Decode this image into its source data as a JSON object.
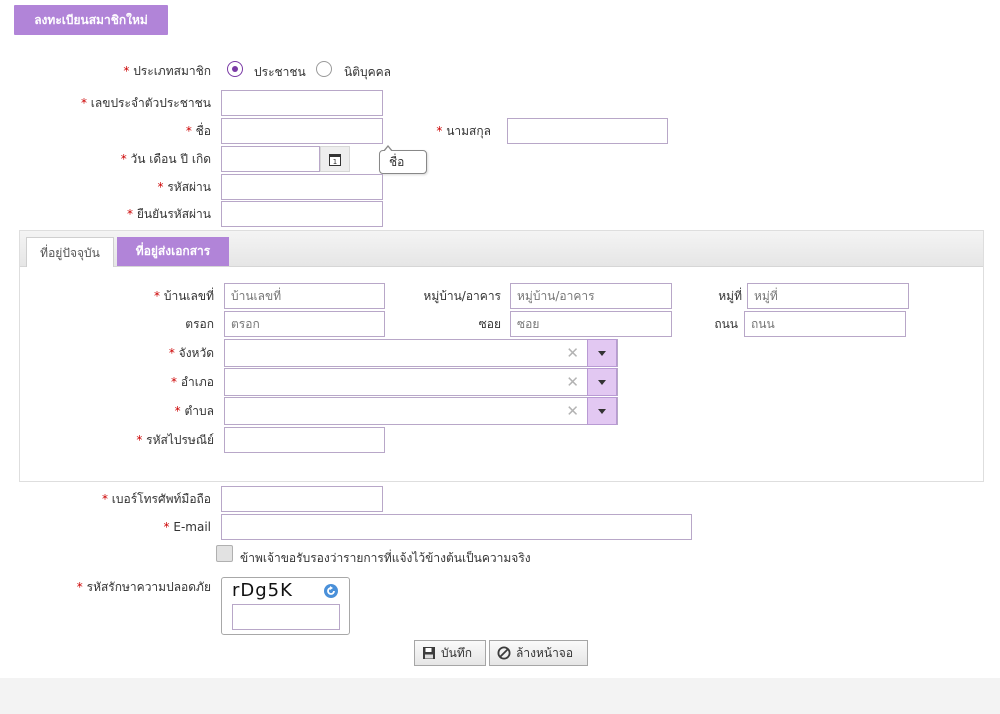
{
  "header": {
    "title": "ลงทะเบียนสมาชิกใหม่"
  },
  "form": {
    "member_type": {
      "label": "ประเภทสมาชิก",
      "options": [
        "ประชาชน",
        "นิติบุคคล"
      ],
      "selected": "ประชาชน"
    },
    "citizen_id": {
      "label": "เลขประจำตัวประชาชน",
      "value": ""
    },
    "first_name": {
      "label": "ชื่อ",
      "value": ""
    },
    "last_name": {
      "label": "นามสกุล",
      "value": ""
    },
    "birth_date": {
      "label": "วัน เดือน ปี เกิด",
      "value": ""
    },
    "password": {
      "label": "รหัสผ่าน",
      "value": ""
    },
    "confirm_password": {
      "label": "ยืนยันรหัสผ่าน",
      "value": ""
    },
    "tooltip": "ชื่อ",
    "required_mark": "*",
    "tabs": [
      "ที่อยู่ปัจจุบัน",
      "ที่อยู่ส่งเอกสาร"
    ],
    "address": {
      "house_no": {
        "label": "บ้านเลขที่",
        "placeholder": "บ้านเลขที่"
      },
      "village": {
        "label": "หมู่บ้าน/อาคาร",
        "placeholder": "หมู่บ้าน/อาคาร"
      },
      "moo": {
        "label": "หมู่ที่",
        "placeholder": "หมู่ที่"
      },
      "trok": {
        "label": "ตรอก",
        "placeholder": "ตรอก"
      },
      "soi": {
        "label": "ซอย",
        "placeholder": "ซอย"
      },
      "road": {
        "label": "ถนน",
        "placeholder": "ถนน"
      },
      "province": {
        "label": "จังหวัด",
        "value": ""
      },
      "district": {
        "label": "อำเภอ",
        "value": ""
      },
      "subdistrict": {
        "label": "ตำบล",
        "value": ""
      },
      "postcode": {
        "label": "รหัสไปรษณีย์",
        "value": ""
      }
    },
    "mobile": {
      "label": "เบอร์โทรศัพท์มือถือ",
      "value": ""
    },
    "email": {
      "label": "E-mail",
      "value": ""
    },
    "certify": {
      "label": "ข้าพเจ้าขอรับรองว่ารายการที่แจ้งไว้ข้างต้นเป็นความจริง",
      "checked": false
    },
    "captcha": {
      "label": "รหัสรักษาความปลอดภัย",
      "code": "rDg5K",
      "value": ""
    }
  },
  "buttons": {
    "save": "บันทึก",
    "clear": "ล้างหน้าจอ"
  },
  "colors": {
    "accent": "#b184d8",
    "required": "#cc0000",
    "dropdown": "#e2c8f2"
  },
  "icons": {
    "calendar": "calendar-icon",
    "refresh": "refresh-icon",
    "save": "floppy-icon",
    "clear": "cancel-icon"
  }
}
